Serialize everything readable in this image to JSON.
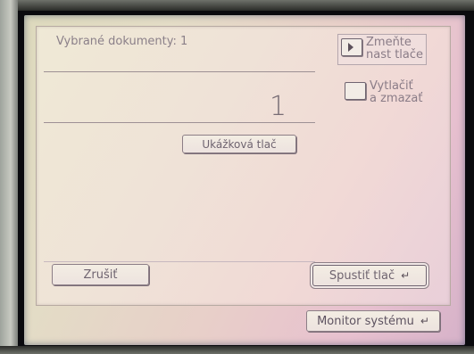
{
  "panel": {
    "selected_docs_label": "Vybrané dokumenty: 1",
    "copies_value": "1",
    "sample_print_label": "Ukážková tlač"
  },
  "side": {
    "change_settings_label_line1": "Zmeňte",
    "change_settings_label_line2": "nast tlače",
    "print_delete_label_line1": "Vytlačiť",
    "print_delete_label_line2": "a zmazať"
  },
  "actions": {
    "cancel_label": "Zrušiť",
    "start_print_label": "Spustiť tlač"
  },
  "footer": {
    "system_monitor_label": "Monitor systému"
  },
  "icons": {
    "start_print_icon": "return-corner-icon",
    "system_monitor_icon": "return-corner-icon",
    "change_settings_icon": "play-arrow-icon"
  }
}
